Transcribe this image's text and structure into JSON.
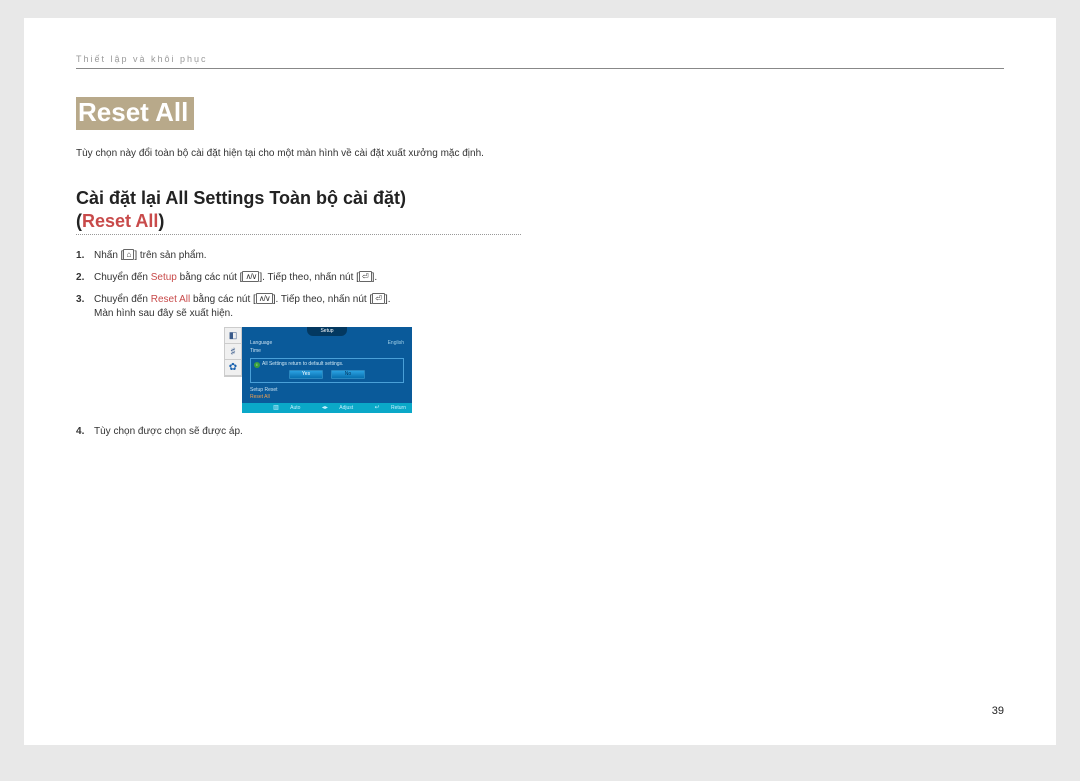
{
  "chapter": "Thiết lập và khôi phục",
  "main_heading": "Reset All",
  "intro": "Tùy chọn này đổi toàn bộ cài đặt hiện tại cho một màn hình về cài đặt xuất xưởng mặc định.",
  "sub_heading": {
    "line1": "Cài đặt lại All Settings Toàn bộ cài đặt)",
    "prefix2": "(",
    "highlight2": "Reset All",
    "suffix2": ")"
  },
  "steps": {
    "s1_a": "Nhấn [",
    "s1_b": "] trên sản phẩm.",
    "s2_a": "Chuyển đến ",
    "s2_hl": "Setup",
    "s2_b": " bằng các nút [",
    "s2_c": "]. Tiếp theo, nhấn nút [",
    "s2_d": "].",
    "s3_a": "Chuyển đến ",
    "s3_hl": "Reset All",
    "s3_b": " bằng các nút [",
    "s3_c": "]. Tiếp theo, nhấn nút [",
    "s3_d": "].",
    "s3_sub": "Màn hình sau đây sẽ xuất hiện.",
    "s4": "Tùy chọn được chọn sẽ được áp."
  },
  "osd": {
    "tab": "Setup",
    "rows": {
      "language_l": "Language",
      "language_r": "English",
      "time": "Time"
    },
    "msg": "All Settings return to default settings.",
    "yes": "Yes",
    "no": "No",
    "setup_reset": "Setup Reset",
    "reset_all": "Reset All",
    "footer_auto": "Auto",
    "footer_adjust": "Adjust",
    "footer_return": "Return"
  },
  "page_number": "39"
}
